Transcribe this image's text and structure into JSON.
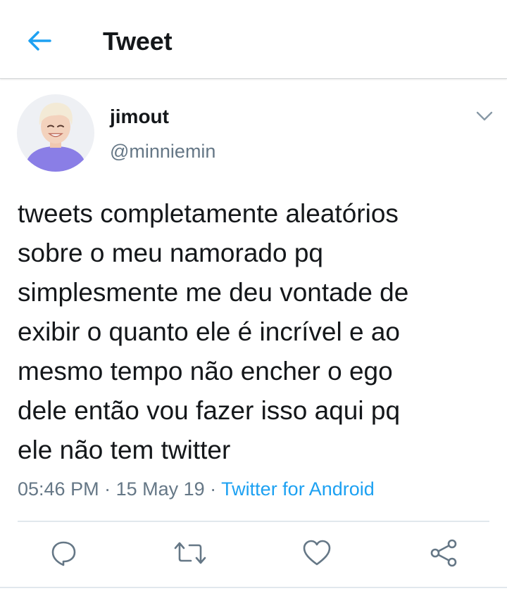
{
  "header": {
    "title": "Tweet",
    "back_icon": "arrow-left-icon"
  },
  "colors": {
    "accent": "#1da1f2",
    "text": "#14171a",
    "secondary": "#657786",
    "divider": "#e1e8ed",
    "avatar_shirt": "#8a7ee6"
  },
  "tweet": {
    "author": {
      "name": "jimout",
      "handle": "@minniemin",
      "avatar_icon": "avatar"
    },
    "text": "tweets completamente aleatórios\nsobre o meu namorado pq\nsimplesmente me deu vontade de\nexibir o quanto ele é incrível e ao\nmesmo tempo não encher o ego\ndele então vou fazer isso aqui pq\nele não tem twitter",
    "time": "05:46 PM",
    "date": "15 May 19",
    "source": "Twitter for Android",
    "separator": " · "
  },
  "actions": [
    {
      "name": "reply",
      "icon": "reply-icon"
    },
    {
      "name": "retweet",
      "icon": "retweet-icon"
    },
    {
      "name": "like",
      "icon": "heart-icon"
    },
    {
      "name": "share",
      "icon": "share-icon"
    }
  ]
}
